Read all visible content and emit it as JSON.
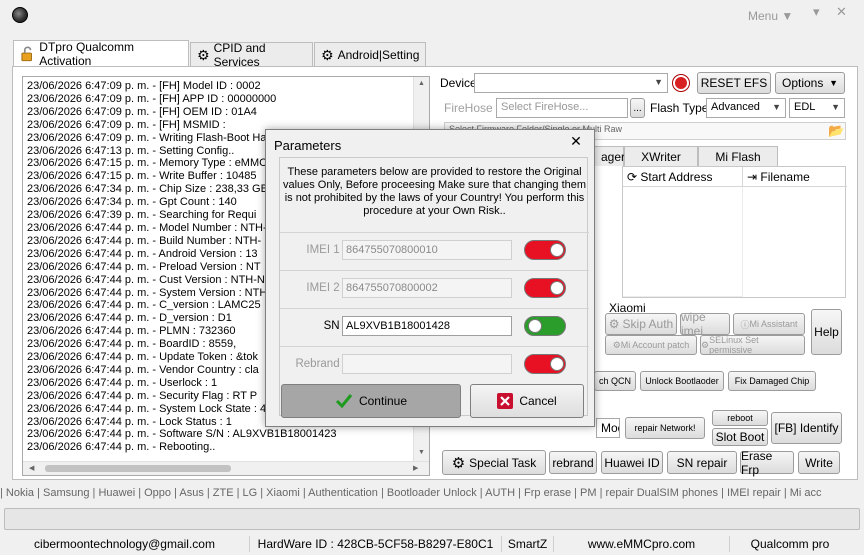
{
  "window": {
    "menu_label": "Menu ▼",
    "min_glyph": "▾",
    "close_glyph": "✕"
  },
  "tabs": [
    {
      "label": "DTpro Qualcomm Activation",
      "icon": "unlock-icon"
    },
    {
      "label": "CPID and Services",
      "icon": "gear-icon"
    },
    {
      "label": "Android|Setting",
      "icon": "gears-icon"
    }
  ],
  "log": {
    "lines": [
      "23/06/2026 6:47:09 p. m. - [FH] Model ID : 0002",
      "23/06/2026 6:47:09 p. m. - [FH] APP ID : 00000000",
      "23/06/2026 6:47:09 p. m. - [FH] OEM ID : 01A4",
      "23/06/2026 6:47:09 p. m. - [FH] MSMID :",
      "23/06/2026 6:47:09 p. m. - Writing Flash-Boot Hash :",
      "23/06/2026 6:47:13 p. m. - Setting Config..",
      "23/06/2026 6:47:15 p. m. - Memory Type : eMMC",
      "23/06/2026 6:47:15 p. m. - Write Buffer : 10485",
      "23/06/2026 6:47:34 p. m. - Chip Size : 238,33 GB",
      "23/06/2026 6:47:34 p. m. - Gpt Count : 140",
      "23/06/2026 6:47:39 p. m. - Searching for Requi",
      "23/06/2026 6:47:44 p. m. - Model Number : NTH-",
      "23/06/2026 6:47:44 p. m. - Build Number : NTH-",
      "23/06/2026 6:47:44 p. m. - Android Version : 13",
      "23/06/2026 6:47:44 p. m. - Preload Version : NT",
      "23/06/2026 6:47:44 p. m. - Cust Version : NTH-N",
      "23/06/2026 6:47:44 p. m. - System Version : NTH",
      "23/06/2026 6:47:44 p. m. - C_version : LAMC25",
      "23/06/2026 6:47:44 p. m. - D_version : D1",
      "23/06/2026 6:47:44 p. m. - PLMN : 732360",
      "23/06/2026 6:47:44 p. m. - BoardID : 8559,",
      "23/06/2026 6:47:44 p. m. - Update Token : &tok",
      "23/06/2026 6:47:44 p. m. - Vendor Country : cla",
      "23/06/2026 6:47:44 p. m. - Userlock : 1",
      "23/06/2026 6:47:44 p. m. - Security Flag : RT P",
      "23/06/2026 6:47:44 p. m. - System Lock State : 4",
      "23/06/2026 6:47:44 p. m. - Lock Status : 1",
      "23/06/2026 6:47:44 p. m. - Software S/N : AL9XVB1B18001423",
      "23/06/2026 6:47:44 p. m. - Rebooting.."
    ]
  },
  "device_panel": {
    "device_label": "Device",
    "reset_efs": "RESET EFS",
    "options": "Options",
    "firehose_label": "FireHose",
    "firehose_placeholder": "Select FireHose...",
    "browse": "...",
    "flash_type_label": "Flash Type",
    "flash_type_value": "Advanced",
    "mode_value": "EDL",
    "firmware_text": "Select Firmware Folder/Single or Multi Raw",
    "subtabs": [
      "ager",
      "XWriter",
      "Mi Flash"
    ],
    "grid_headers": [
      "Start Address",
      "Filename"
    ],
    "xiaomi_label": "Xiaomi",
    "skip_auth": "Skip Auth",
    "wipe_imei": "wipe imei",
    "mi_assistant": "Mi Assistant",
    "mi_account_patch": "Mi Account patch",
    "selinux": "SELinux Set permissive",
    "help": "Help",
    "patch_qcn": "ch QCN",
    "unlock_bootloader": "Unlock Bootlaoder",
    "fix_damaged_chip": "Fix Damaged Chip",
    "model_partial": "Model : Honor 90 lite [Newton",
    "repair_network": "repair Network!",
    "reboot": "reboot",
    "slot_boot": "Slot Boot",
    "fb_identify": "[FB] Identify",
    "special_task": "Special Task",
    "rebrand": "rebrand",
    "huawei_id": "Huawei ID",
    "sn_repair": "SN repair",
    "erase_frp": "Erase Frp",
    "write": "Write"
  },
  "brand_bar": "| Nokia | Samsung | Huawei | Oppo | Asus | ZTE | LG | Xiaomi | Authentication | Bootloader Unlock | AUTH | Frp erase | PM | repair DualSIM phones | IMEI repair | Mi acc",
  "status_bar": {
    "email": "cibermoontechnology@gmail.com",
    "hardware_id": "HardWare ID : 428CB-5CF58-B8297-E80C1",
    "smartz": "SmartZ",
    "site": "www.eMMCpro.com",
    "mode": "Qualcomm pro"
  },
  "dialog": {
    "title": "Parameters",
    "close": "✕",
    "warning": "These parameters below are provided to restore the Original values Only, Before proceesing Make sure that changing them is not prohibited by the laws of your Country! You perform this procedure at your Own Risk..",
    "rows": [
      {
        "label": "IMEI 1 :",
        "value": "864755070800010",
        "enabled": false,
        "on": false
      },
      {
        "label": "IMEI 2 :",
        "value": "864755070800002",
        "enabled": false,
        "on": false
      },
      {
        "label": "SN :",
        "value": "AL9XVB1B18001428",
        "enabled": true,
        "on": true
      },
      {
        "label": "Rebrand :",
        "value": "",
        "enabled": false,
        "on": false
      }
    ],
    "continue_label": "Continue",
    "cancel_label": "Cancel"
  },
  "colors": {
    "toggle_off": "#e81123",
    "toggle_on": "#2a9d2a",
    "tab_border": "#bdbdbd"
  }
}
